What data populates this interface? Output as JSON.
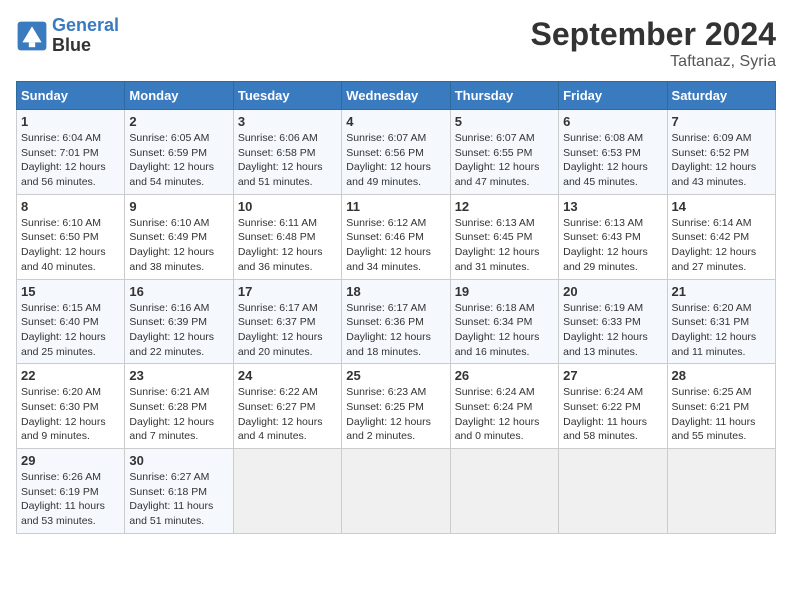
{
  "header": {
    "logo_line1": "General",
    "logo_line2": "Blue",
    "main_title": "September 2024",
    "subtitle": "Taftanaz, Syria"
  },
  "days_of_week": [
    "Sunday",
    "Monday",
    "Tuesday",
    "Wednesday",
    "Thursday",
    "Friday",
    "Saturday"
  ],
  "weeks": [
    [
      {
        "day": "1",
        "info": "Sunrise: 6:04 AM\nSunset: 7:01 PM\nDaylight: 12 hours\nand 56 minutes."
      },
      {
        "day": "2",
        "info": "Sunrise: 6:05 AM\nSunset: 6:59 PM\nDaylight: 12 hours\nand 54 minutes."
      },
      {
        "day": "3",
        "info": "Sunrise: 6:06 AM\nSunset: 6:58 PM\nDaylight: 12 hours\nand 51 minutes."
      },
      {
        "day": "4",
        "info": "Sunrise: 6:07 AM\nSunset: 6:56 PM\nDaylight: 12 hours\nand 49 minutes."
      },
      {
        "day": "5",
        "info": "Sunrise: 6:07 AM\nSunset: 6:55 PM\nDaylight: 12 hours\nand 47 minutes."
      },
      {
        "day": "6",
        "info": "Sunrise: 6:08 AM\nSunset: 6:53 PM\nDaylight: 12 hours\nand 45 minutes."
      },
      {
        "day": "7",
        "info": "Sunrise: 6:09 AM\nSunset: 6:52 PM\nDaylight: 12 hours\nand 43 minutes."
      }
    ],
    [
      {
        "day": "8",
        "info": "Sunrise: 6:10 AM\nSunset: 6:50 PM\nDaylight: 12 hours\nand 40 minutes."
      },
      {
        "day": "9",
        "info": "Sunrise: 6:10 AM\nSunset: 6:49 PM\nDaylight: 12 hours\nand 38 minutes."
      },
      {
        "day": "10",
        "info": "Sunrise: 6:11 AM\nSunset: 6:48 PM\nDaylight: 12 hours\nand 36 minutes."
      },
      {
        "day": "11",
        "info": "Sunrise: 6:12 AM\nSunset: 6:46 PM\nDaylight: 12 hours\nand 34 minutes."
      },
      {
        "day": "12",
        "info": "Sunrise: 6:13 AM\nSunset: 6:45 PM\nDaylight: 12 hours\nand 31 minutes."
      },
      {
        "day": "13",
        "info": "Sunrise: 6:13 AM\nSunset: 6:43 PM\nDaylight: 12 hours\nand 29 minutes."
      },
      {
        "day": "14",
        "info": "Sunrise: 6:14 AM\nSunset: 6:42 PM\nDaylight: 12 hours\nand 27 minutes."
      }
    ],
    [
      {
        "day": "15",
        "info": "Sunrise: 6:15 AM\nSunset: 6:40 PM\nDaylight: 12 hours\nand 25 minutes."
      },
      {
        "day": "16",
        "info": "Sunrise: 6:16 AM\nSunset: 6:39 PM\nDaylight: 12 hours\nand 22 minutes."
      },
      {
        "day": "17",
        "info": "Sunrise: 6:17 AM\nSunset: 6:37 PM\nDaylight: 12 hours\nand 20 minutes."
      },
      {
        "day": "18",
        "info": "Sunrise: 6:17 AM\nSunset: 6:36 PM\nDaylight: 12 hours\nand 18 minutes."
      },
      {
        "day": "19",
        "info": "Sunrise: 6:18 AM\nSunset: 6:34 PM\nDaylight: 12 hours\nand 16 minutes."
      },
      {
        "day": "20",
        "info": "Sunrise: 6:19 AM\nSunset: 6:33 PM\nDaylight: 12 hours\nand 13 minutes."
      },
      {
        "day": "21",
        "info": "Sunrise: 6:20 AM\nSunset: 6:31 PM\nDaylight: 12 hours\nand 11 minutes."
      }
    ],
    [
      {
        "day": "22",
        "info": "Sunrise: 6:20 AM\nSunset: 6:30 PM\nDaylight: 12 hours\nand 9 minutes."
      },
      {
        "day": "23",
        "info": "Sunrise: 6:21 AM\nSunset: 6:28 PM\nDaylight: 12 hours\nand 7 minutes."
      },
      {
        "day": "24",
        "info": "Sunrise: 6:22 AM\nSunset: 6:27 PM\nDaylight: 12 hours\nand 4 minutes."
      },
      {
        "day": "25",
        "info": "Sunrise: 6:23 AM\nSunset: 6:25 PM\nDaylight: 12 hours\nand 2 minutes."
      },
      {
        "day": "26",
        "info": "Sunrise: 6:24 AM\nSunset: 6:24 PM\nDaylight: 12 hours\nand 0 minutes."
      },
      {
        "day": "27",
        "info": "Sunrise: 6:24 AM\nSunset: 6:22 PM\nDaylight: 11 hours\nand 58 minutes."
      },
      {
        "day": "28",
        "info": "Sunrise: 6:25 AM\nSunset: 6:21 PM\nDaylight: 11 hours\nand 55 minutes."
      }
    ],
    [
      {
        "day": "29",
        "info": "Sunrise: 6:26 AM\nSunset: 6:19 PM\nDaylight: 11 hours\nand 53 minutes."
      },
      {
        "day": "30",
        "info": "Sunrise: 6:27 AM\nSunset: 6:18 PM\nDaylight: 11 hours\nand 51 minutes."
      },
      {
        "day": "",
        "info": ""
      },
      {
        "day": "",
        "info": ""
      },
      {
        "day": "",
        "info": ""
      },
      {
        "day": "",
        "info": ""
      },
      {
        "day": "",
        "info": ""
      }
    ]
  ]
}
